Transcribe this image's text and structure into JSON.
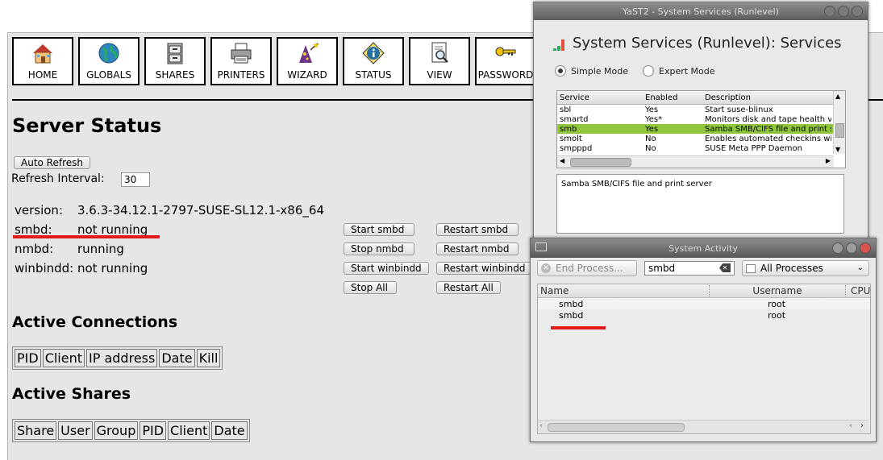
{
  "nav": {
    "items": [
      {
        "label": "HOME",
        "icon": "house-icon"
      },
      {
        "label": "GLOBALS",
        "icon": "globe-icon"
      },
      {
        "label": "SHARES",
        "icon": "file-cabinet-icon"
      },
      {
        "label": "PRINTERS",
        "icon": "printer-icon"
      },
      {
        "label": "WIZARD",
        "icon": "wizard-hat-icon"
      },
      {
        "label": "STATUS",
        "icon": "info-icon"
      },
      {
        "label": "VIEW",
        "icon": "magnifier-document-icon"
      },
      {
        "label": "PASSWORD",
        "icon": "keys-icon"
      }
    ]
  },
  "page": {
    "title": "Server Status",
    "auto_refresh": "Auto Refresh",
    "refresh_interval_label": "Refresh Interval:",
    "refresh_interval_value": "30"
  },
  "status": {
    "version_label": "version:",
    "version_value": "3.6.3-34.12.1-2797-SUSE-SL12.1-x86_64",
    "smbd_label": "smbd:",
    "smbd_value": "not running",
    "nmbd_label": "nmbd:",
    "nmbd_value": "running",
    "winbindd_label": "winbindd:",
    "winbindd_value": "not running"
  },
  "actions": {
    "start_smbd": "Start smbd",
    "restart_smbd": "Restart smbd",
    "stop_nmbd": "Stop nmbd",
    "restart_nmbd": "Restart nmbd",
    "start_winbindd": "Start winbindd",
    "restart_winbindd": "Restart winbindd",
    "stop_all": "Stop All",
    "restart_all": "Restart All"
  },
  "connections": {
    "title": "Active Connections",
    "columns": [
      "PID",
      "Client",
      "IP address",
      "Date",
      "Kill"
    ]
  },
  "shares": {
    "title": "Active Shares",
    "columns": [
      "Share",
      "User",
      "Group",
      "PID",
      "Client",
      "Date"
    ]
  },
  "yast": {
    "window_title": "YaST2 - System Services (Runlevel)",
    "heading": "System Services (Runlevel): Services",
    "simple_mode": "Simple Mode",
    "expert_mode": "Expert Mode",
    "columns": [
      "Service",
      "Enabled",
      "Description"
    ],
    "rows": [
      {
        "service": "sbl",
        "enabled": "Yes",
        "description": "Start suse-blinux"
      },
      {
        "service": "smartd",
        "enabled": "Yes*",
        "description": "Monitors disk and tape health via"
      },
      {
        "service": "smb",
        "enabled": "Yes",
        "description": "Samba SMB/CIFS file and print se"
      },
      {
        "service": "smolt",
        "enabled": "No",
        "description": "Enables automated checkins with"
      },
      {
        "service": "smpppd",
        "enabled": "No",
        "description": "SUSE Meta PPP Daemon"
      }
    ],
    "selected_description": "Samba SMB/CIFS file and print server"
  },
  "sysact": {
    "window_title": "System Activity",
    "end_process": "End Process...",
    "search_value": "smbd",
    "filter_value": "All Processes",
    "columns": [
      "Name",
      "Username",
      "CPU"
    ],
    "rows": [
      {
        "name": "smbd",
        "user": "root"
      },
      {
        "name": "smbd",
        "user": "root"
      }
    ]
  },
  "colors": {
    "highlight_red": "#e11b1b",
    "selection_green": "#8fc63b"
  }
}
